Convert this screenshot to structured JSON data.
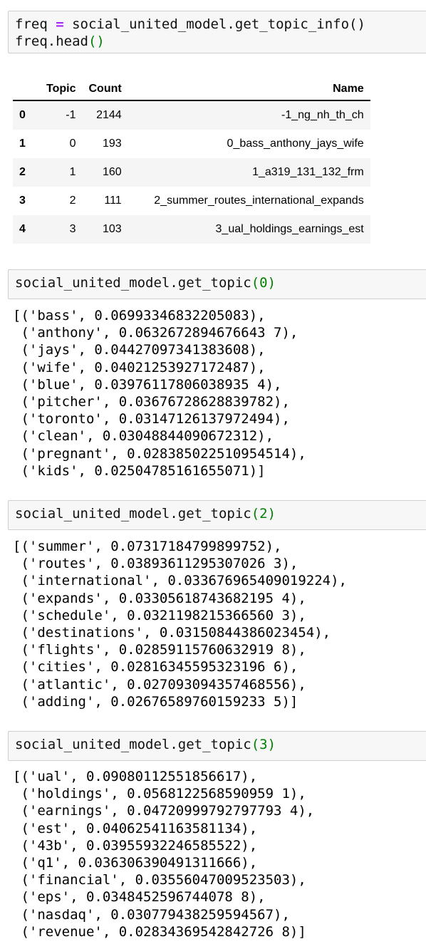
{
  "cell1": {
    "line1_a": "freq ",
    "line1_eq": "=",
    "line1_b": " social_united_model.get_topic_info()",
    "line2_a": "freq.head",
    "line2_paren": "()"
  },
  "df": {
    "columns": [
      "",
      "Topic",
      "Count",
      "Name"
    ],
    "rows": [
      [
        "0",
        "-1",
        "2144",
        "-1_ng_nh_th_ch"
      ],
      [
        "1",
        "0",
        "193",
        "0_bass_anthony_jays_wife"
      ],
      [
        "2",
        "1",
        "160",
        "1_a319_131_132_frm"
      ],
      [
        "3",
        "2",
        "111",
        "2_summer_routes_international_expands"
      ],
      [
        "4",
        "3",
        "103",
        "3_ual_holdings_earnings_est"
      ]
    ]
  },
  "cell2": {
    "code": "social_united_model.get_topic",
    "arg": "(0)"
  },
  "out2": "[('bass', 0.06993346832205083),\n ('anthony', 0.0632672894676643 7),\n ('jays', 0.04427097341383608),\n ('wife', 0.04021253927172487),\n ('blue', 0.03976117806038935 4),\n ('pitcher', 0.03676728628839782),\n ('toronto', 0.03147126137972494),\n ('clean', 0.03048844090672312),\n ('pregnant', 0.028385022510954514),\n ('kids', 0.02504785161655071)]",
  "cell3": {
    "code": "social_united_model.get_topic",
    "arg": "(2)"
  },
  "out3": "[('summer', 0.07317184799899752),\n ('routes', 0.03893611295307026 3),\n ('international', 0.033676965409019224),\n ('expands', 0.03305618743682195 4),\n ('schedule', 0.0321198215366560 3),\n ('destinations', 0.03150844386023454),\n ('flights', 0.02859115760632919 8),\n ('cities', 0.02816345595323196 6),\n ('atlantic', 0.027093094357468556),\n ('adding', 0.02676589760159233 5)]",
  "cell4": {
    "code": "social_united_model.get_topic",
    "arg": "(3)"
  },
  "out4": "[('ual', 0.09080112551856617),\n ('holdings', 0.0568122568590959 1),\n ('earnings', 0.04720999792797793 4),\n ('est', 0.04062541163581134),\n ('43b', 0.03955932246585522),\n ('q1', 0.036306390491311666),\n ('financial', 0.03556047009523503),\n ('eps', 0.0348452596744078 8),\n ('nasdaq', 0.030779438259594567),\n ('revenue', 0.02834369542842726 8)]"
}
